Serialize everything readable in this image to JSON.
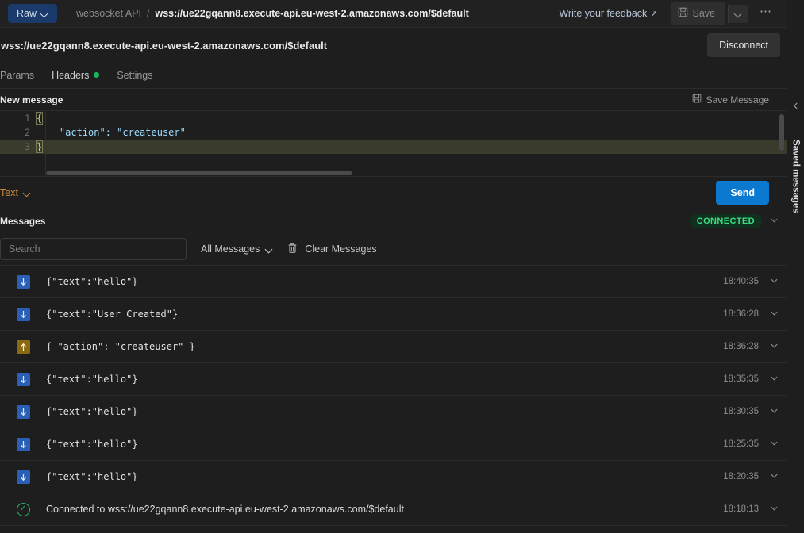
{
  "topbar": {
    "raw_tab_label": "Raw",
    "breadcrumb_collection": "websocket API",
    "breadcrumb_separator": "/",
    "breadcrumb_current": "wss://ue22gqann8.execute-api.eu-west-2.amazonaws.com/$default",
    "feedback_label": "Write your feedback",
    "feedback_arrow": "↗",
    "save_label": "Save",
    "more_label": "⋯"
  },
  "url_bar": {
    "value": "wss://ue22gqann8.execute-api.eu-west-2.amazonaws.com/$default",
    "disconnect_label": "Disconnect"
  },
  "request_tabs": [
    {
      "label": "Params",
      "active": false,
      "has_dot": false
    },
    {
      "label": "Headers",
      "active": true,
      "has_dot": true
    },
    {
      "label": "Settings",
      "active": false,
      "has_dot": false
    }
  ],
  "new_message": {
    "title": "New message",
    "save_message_label": "Save Message",
    "editor_lines": [
      {
        "number": "1",
        "code": "{",
        "active": false
      },
      {
        "number": "2",
        "code": "    \"action\": \"createuser\"",
        "active": false
      },
      {
        "number": "3",
        "code": "}",
        "active": true
      }
    ],
    "body_type": "Text",
    "send_label": "Send"
  },
  "messages_panel": {
    "title": "Messages",
    "status": "CONNECTED",
    "status_color": "#3ddc84",
    "search_placeholder": "Search",
    "search_value": "",
    "filter_label": "All Messages",
    "clear_label": "Clear Messages",
    "rows": [
      {
        "direction": "in",
        "icon": "arrow-down-icon",
        "text": "{\"text\":\"hello\"}",
        "time": "18:40:35"
      },
      {
        "direction": "in",
        "icon": "arrow-down-icon",
        "text": "{\"text\":\"User Created\"}",
        "time": "18:36:28"
      },
      {
        "direction": "out",
        "icon": "arrow-up-icon",
        "text": "{ \"action\": \"createuser\" }",
        "time": "18:36:28"
      },
      {
        "direction": "in",
        "icon": "arrow-down-icon",
        "text": "{\"text\":\"hello\"}",
        "time": "18:35:35"
      },
      {
        "direction": "in",
        "icon": "arrow-down-icon",
        "text": "{\"text\":\"hello\"}",
        "time": "18:30:35"
      },
      {
        "direction": "in",
        "icon": "arrow-down-icon",
        "text": "{\"text\":\"hello\"}",
        "time": "18:25:35"
      },
      {
        "direction": "in",
        "icon": "arrow-down-icon",
        "text": "{\"text\":\"hello\"}",
        "time": "18:20:35"
      },
      {
        "direction": "system",
        "icon": "check-circle-icon",
        "text": "Connected to wss://ue22gqann8.execute-api.eu-west-2.amazonaws.com/$default",
        "time": "18:18:13"
      }
    ]
  },
  "right_rail": {
    "label": "Saved messages"
  },
  "colors": {
    "accent_blue": "#0b79d0",
    "raw_tab_blue": "#1a3a6b",
    "incoming_badge": "#2a5fb5",
    "outgoing_badge": "#8a6914",
    "connected_green": "#3ddc84",
    "body_type_orange": "#c98a3c"
  }
}
